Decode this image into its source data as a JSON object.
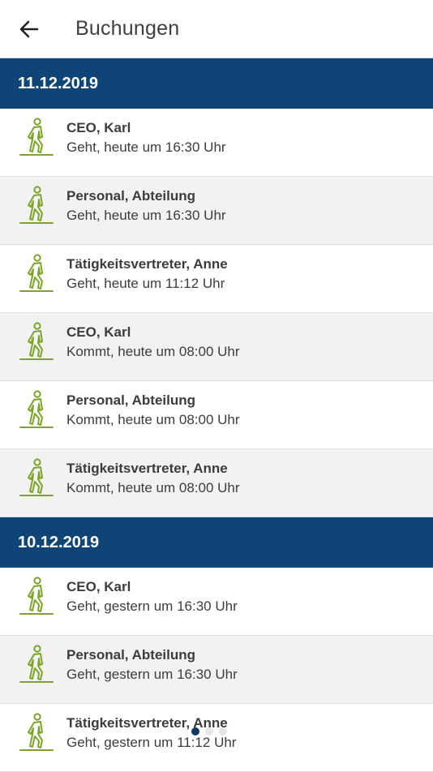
{
  "header": {
    "title": "Buchungen",
    "back_icon": "arrow-left-icon"
  },
  "colors": {
    "date_header_bg": "#0f4576",
    "icon_green": "#7ba428",
    "dot_active": "#0f3a5e"
  },
  "groups": [
    {
      "date": "11.12.2019",
      "entries": [
        {
          "name": "CEO, Karl",
          "detail": "Geht, heute um 16:30 Uhr",
          "icon": "walking-person-icon"
        },
        {
          "name": "Personal, Abteilung",
          "detail": "Geht, heute um 16:30 Uhr",
          "icon": "walking-person-icon"
        },
        {
          "name": "Tätigkeitsvertreter, Anne",
          "detail": "Geht, heute um 11:12 Uhr",
          "icon": "walking-person-icon"
        },
        {
          "name": "CEO, Karl",
          "detail": "Kommt, heute um 08:00 Uhr",
          "icon": "walking-person-icon"
        },
        {
          "name": "Personal, Abteilung",
          "detail": "Kommt, heute um 08:00 Uhr",
          "icon": "walking-person-icon"
        },
        {
          "name": "Tätigkeitsvertreter, Anne",
          "detail": "Kommt, heute um 08:00 Uhr",
          "icon": "walking-person-icon"
        }
      ]
    },
    {
      "date": "10.12.2019",
      "entries": [
        {
          "name": "CEO, Karl",
          "detail": "Geht, gestern um 16:30 Uhr",
          "icon": "walking-person-icon"
        },
        {
          "name": "Personal, Abteilung",
          "detail": "Geht, gestern um 16:30 Uhr",
          "icon": "walking-person-icon"
        },
        {
          "name": "Tätigkeitsvertreter, Anne",
          "detail": "Geht, gestern um 11:12 Uhr",
          "icon": "walking-person-icon"
        }
      ]
    }
  ],
  "page_indicator": {
    "count": 3,
    "active_index": 0
  }
}
